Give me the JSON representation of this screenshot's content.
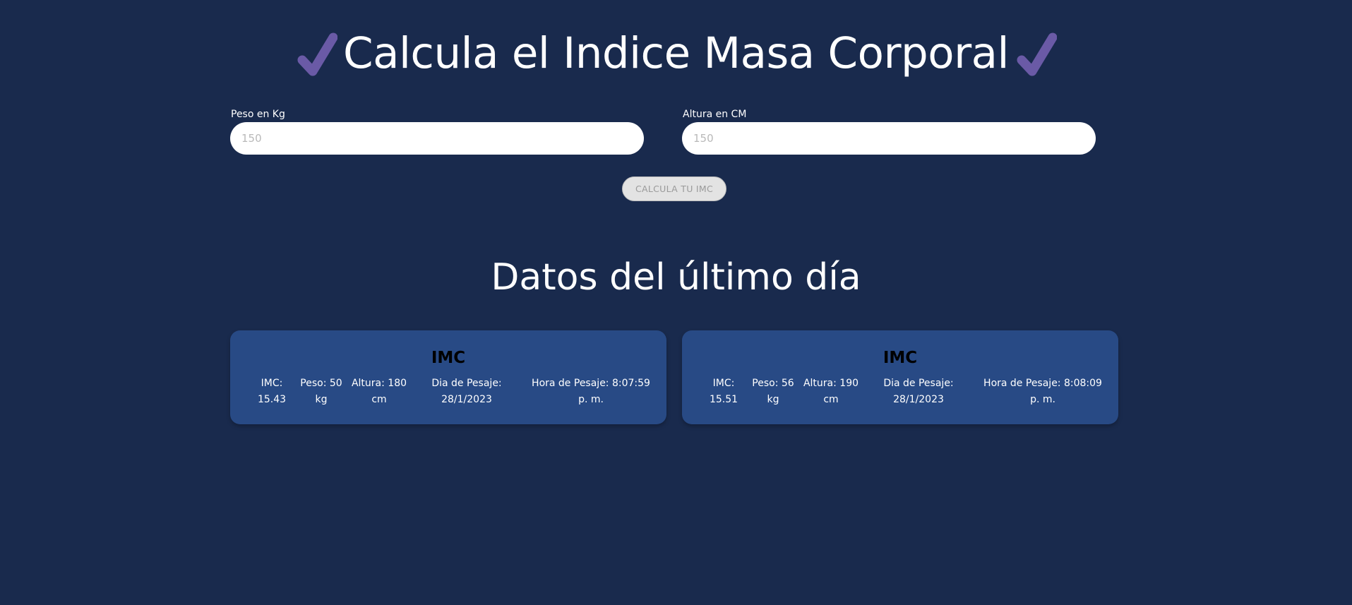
{
  "header": {
    "title": "Calcula el Indice Masa Corporal",
    "check_icon_color": "#6a5aa6"
  },
  "form": {
    "peso": {
      "label": "Peso en Kg",
      "placeholder": "150",
      "value": ""
    },
    "altura": {
      "label": "Altura en CM",
      "placeholder": "150",
      "value": ""
    },
    "button_label": "CALCULA TU IMC"
  },
  "results": {
    "section_title": "Datos del último día",
    "cards": [
      {
        "title": "IMC",
        "imc_line1": "IMC:",
        "imc_line2": "15.43",
        "peso_line1": "Peso: 50",
        "peso_line2": "kg",
        "altura_line1": "Altura: 180",
        "altura_line2": "cm",
        "dia_line1": "Dia de Pesaje:",
        "dia_line2": "28/1/2023",
        "hora_line1": "Hora de Pesaje: 8:07:59",
        "hora_line2": "p. m."
      },
      {
        "title": "IMC",
        "imc_line1": "IMC:",
        "imc_line2": "15.51",
        "peso_line1": "Peso: 56",
        "peso_line2": "kg",
        "altura_line1": "Altura: 190",
        "altura_line2": "cm",
        "dia_line1": "Dia de Pesaje:",
        "dia_line2": "28/1/2023",
        "hora_line1": "Hora de Pesaje: 8:08:09",
        "hora_line2": "p. m."
      }
    ]
  },
  "colors": {
    "background": "#192a4d",
    "card": "#284a85"
  }
}
